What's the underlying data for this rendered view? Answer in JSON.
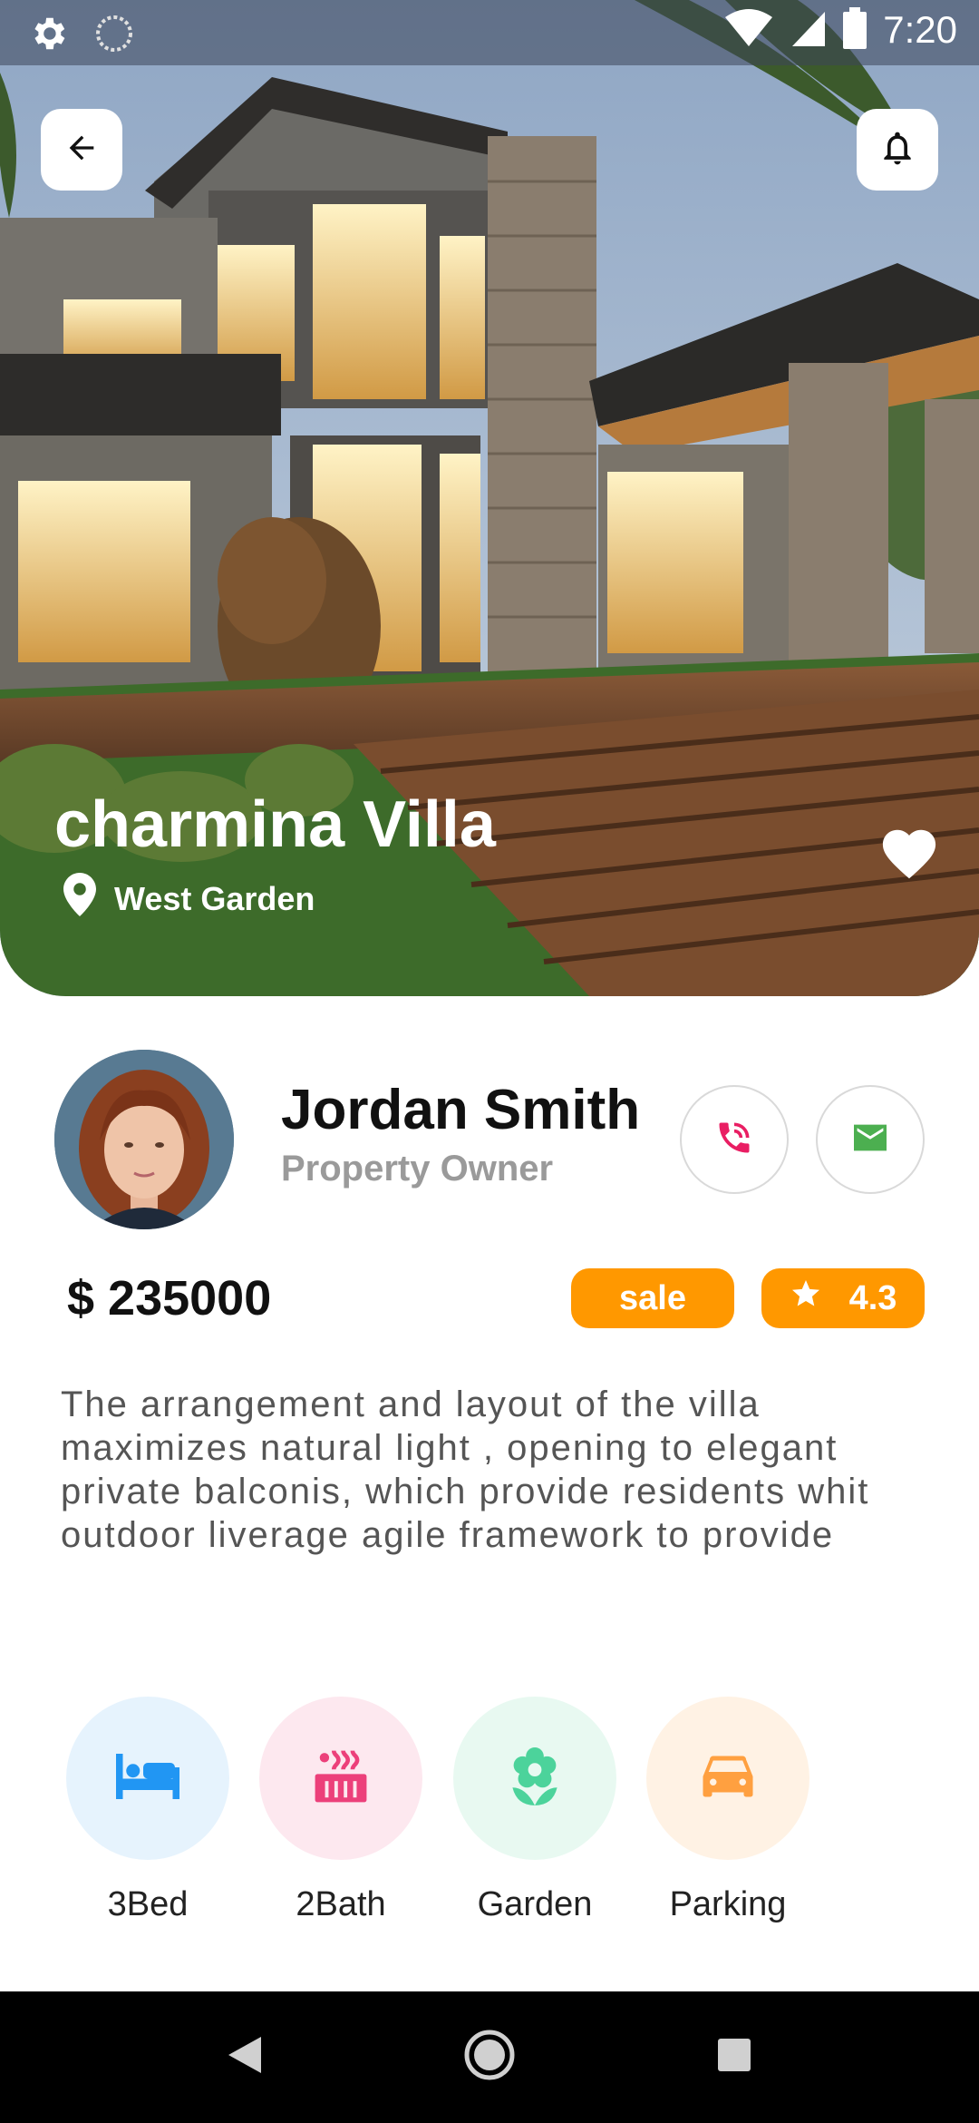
{
  "status_bar": {
    "time": "7:20",
    "left_icons": [
      "gear-icon",
      "loading-circle-icon"
    ],
    "right_icons": [
      "wifi-icon",
      "signal-icon",
      "battery-icon"
    ]
  },
  "hero": {
    "title": "charmina Villa",
    "location": "West Garden",
    "back_icon": "arrow-left-icon",
    "bell_icon": "bell-icon",
    "favorite_icon": "heart-icon"
  },
  "owner": {
    "name": "Jordan Smith",
    "role": "Property Owner",
    "call_color": "#e91e63",
    "mail_color": "#4caf50"
  },
  "listing": {
    "price": "$ 235000",
    "status": "sale",
    "rating": "4.3",
    "accent": "#ff9800"
  },
  "description": "The arrangement and layout of the villa maximizes natural light , opening to elegant private balconis, which provide residents whit outdoor liverage agile framework to provide",
  "features": [
    {
      "label": "3Bed",
      "icon": "bed-icon",
      "color": "#2196f3",
      "bg": "#e6f3fd"
    },
    {
      "label": "2Bath",
      "icon": "hot-tub-icon",
      "color": "#ec407a",
      "bg": "#fde8ef"
    },
    {
      "label": "Garden",
      "icon": "flower-icon",
      "color": "#4cd39b",
      "bg": "#e8f9f1"
    },
    {
      "label": "Parking",
      "icon": "car-icon",
      "color": "#ffa040",
      "bg": "#fff2e4"
    }
  ]
}
